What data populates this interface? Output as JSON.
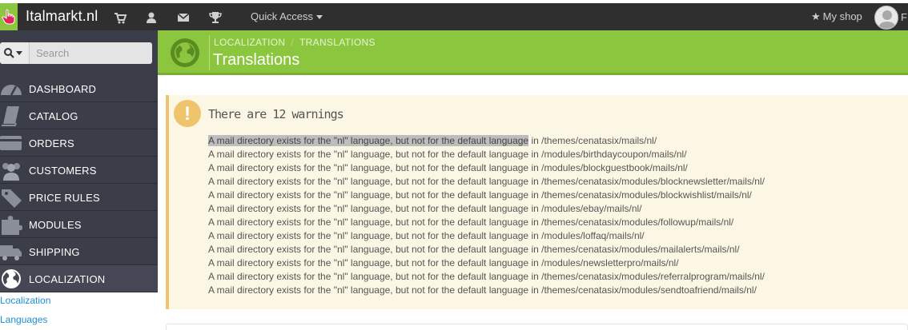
{
  "topbar": {
    "brand": "Italmarkt.nl",
    "quick_access": "Quick Access",
    "my_shop": "My shop",
    "user_initial": "F"
  },
  "icons": {
    "logo": "pointer-hand-icon",
    "cart": "cart-icon",
    "user": "user-icon",
    "mail": "envelope-icon",
    "trophy": "trophy-icon",
    "star": "star-icon",
    "search": "search-icon",
    "globe": "globe-icon",
    "warning": "exclamation-icon"
  },
  "colors": {
    "topbar": "#2f2f2f",
    "accent_green": "#8cc63f",
    "sidebar": "#3b3e48",
    "warning_bg": "#fcf7e4",
    "warning_border": "#f0c36d",
    "link": "#1f8fcf"
  },
  "sidebar": {
    "search_placeholder": "Search",
    "items": [
      {
        "label": "DASHBOARD"
      },
      {
        "label": "CATALOG"
      },
      {
        "label": "ORDERS"
      },
      {
        "label": "CUSTOMERS"
      },
      {
        "label": "PRICE RULES"
      },
      {
        "label": "MODULES"
      },
      {
        "label": "SHIPPING"
      },
      {
        "label": "LOCALIZATION"
      }
    ],
    "submenu": [
      "Localization",
      "Languages"
    ]
  },
  "header": {
    "breadcrumb": [
      "LOCALIZATION",
      "TRANSLATIONS"
    ],
    "breadcrumb_sep": "/",
    "title": "Translations"
  },
  "warning": {
    "icon_glyph": "!",
    "title": "There are 12 warnings",
    "message": "A mail directory exists for the \"nl\" language, but not for the default language",
    "joiner": " in ",
    "paths": [
      "/themes/cenatasix/mails/nl/",
      "/modules/birthdaycoupon/mails/nl/",
      "/modules/blockguestbook/mails/nl/",
      "/themes/cenatasix/modules/blocknewsletter/mails/nl/",
      "/themes/cenatasix/modules/blockwishlist/mails/nl/",
      "/modules/ebay/mails/nl/",
      "/themes/cenatasix/modules/followup/mails/nl/",
      "/modules/loffaq/mails/nl/",
      "/themes/cenatasix/modules/mailalerts/mails/nl/",
      "/modules/newsletterpro/mails/nl/",
      "/themes/cenatasix/modules/referralprogram/mails/nl/",
      "/themes/cenatasix/modules/sendtoafriend/mails/nl/"
    ]
  }
}
